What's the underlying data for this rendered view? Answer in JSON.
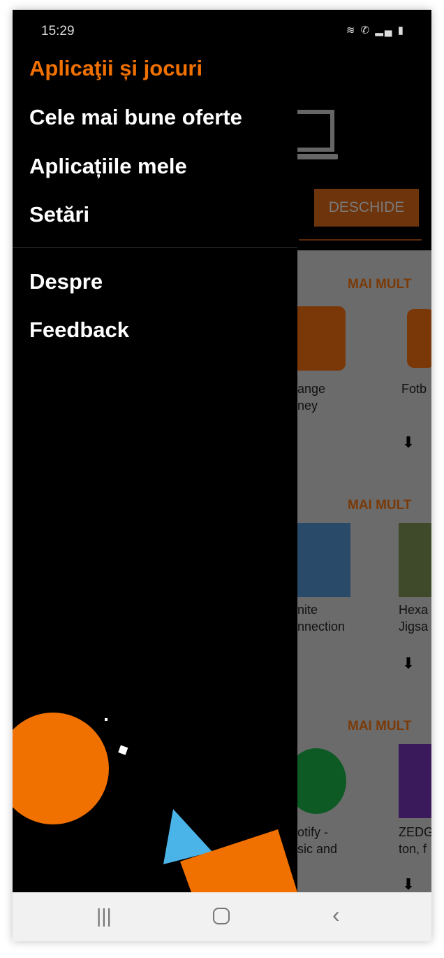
{
  "status_bar": {
    "time": "15:29",
    "icons": [
      "wifi-icon",
      "wifi-call-icon",
      "signal-icon",
      "battery-icon"
    ]
  },
  "drawer": {
    "items": [
      {
        "label": "Aplicaţii și jocuri",
        "active": true
      },
      {
        "label": "Cele mai bune oferte"
      },
      {
        "label": "Aplicațiile mele"
      },
      {
        "label": "Setări"
      },
      {
        "label": "Despre"
      },
      {
        "label": "Feedback"
      }
    ]
  },
  "background": {
    "open_button": "DESCHIDE",
    "sections": [
      {
        "more": "MAI MULT",
        "apps": [
          {
            "name": "ange\nney"
          },
          {
            "name": "Fotb"
          }
        ]
      },
      {
        "more": "MAI MULT",
        "apps": [
          {
            "name": "nite\nnnection"
          },
          {
            "name": "Hexa\nJigsa"
          }
        ]
      },
      {
        "more": "MAI MULT",
        "apps": [
          {
            "name": "otify -\nsic and"
          },
          {
            "name": "ZEDG\nton, f"
          }
        ]
      }
    ]
  },
  "colors": {
    "accent": "#f07000",
    "drawer": "#000000",
    "triangle": "#4ab3e8"
  }
}
